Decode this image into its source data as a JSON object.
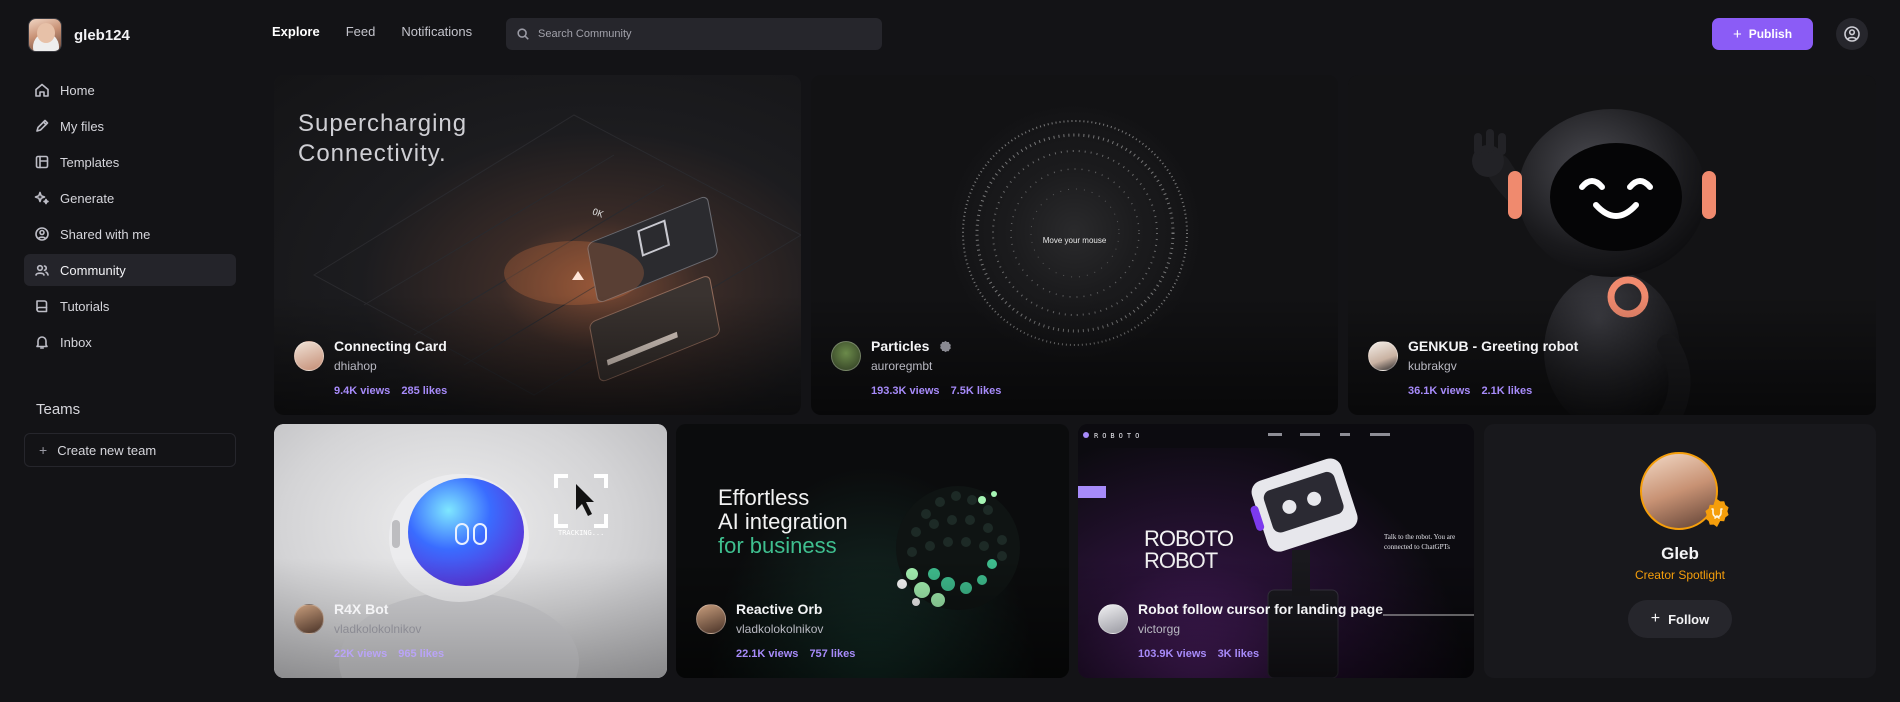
{
  "user": {
    "username": "gleb124"
  },
  "sidebar": {
    "items": [
      {
        "label": "Home",
        "icon": "home-icon"
      },
      {
        "label": "My files",
        "icon": "pen-icon"
      },
      {
        "label": "Templates",
        "icon": "template-icon"
      },
      {
        "label": "Generate",
        "icon": "sparkle-icon"
      },
      {
        "label": "Shared with me",
        "icon": "user-circle-icon"
      },
      {
        "label": "Community",
        "icon": "users-icon",
        "active": true
      },
      {
        "label": "Tutorials",
        "icon": "book-icon"
      },
      {
        "label": "Inbox",
        "icon": "bell-icon"
      }
    ],
    "teams_label": "Teams",
    "create_team_label": "Create new team"
  },
  "topnav": {
    "tabs": [
      "Explore",
      "Feed",
      "Notifications"
    ],
    "active": "Explore"
  },
  "search": {
    "placeholder": "Search Community"
  },
  "publish_label": "Publish",
  "cards": [
    {
      "title": "Connecting Card",
      "author": "dhiahop",
      "views": "9.4K views",
      "likes": "285 likes",
      "art_text": [
        "Supercharging",
        "Connectivity."
      ],
      "art_small": "OK"
    },
    {
      "title": "Particles",
      "author": "auroregmbt",
      "views": "193.3K views",
      "likes": "7.5K likes",
      "art_text": "Move your mouse"
    },
    {
      "title": "GENKUB - Greeting robot",
      "author": "kubrakgv",
      "views": "36.1K views",
      "likes": "2.1K likes"
    },
    {
      "title": "R4X Bot",
      "author": "vladkolokolnikov",
      "views": "22K views",
      "likes": "965 likes",
      "art_text": "TRACKING..."
    },
    {
      "title": "Reactive Orb",
      "author": "vladkolokolnikov",
      "views": "22.1K views",
      "likes": "757 likes",
      "art_text": [
        "Effortless",
        "AI integration",
        "for business"
      ]
    },
    {
      "title": "Robot follow cursor for landing page",
      "author": "victorgg",
      "views": "103.9K views",
      "likes": "3K likes",
      "art_text": [
        "ROBOTO",
        "ROBOT"
      ],
      "art_brand": "ROBOTO",
      "art_side": "Talk to the robot. You are connected to ChatGPTs"
    }
  ],
  "spotlight": {
    "name": "Gleb",
    "role": "Creator Spotlight",
    "follow_label": "Follow"
  },
  "colors": {
    "accent": "#8b5cf6",
    "stats": "#a78bfa",
    "spotlight": "#f59e0b"
  }
}
